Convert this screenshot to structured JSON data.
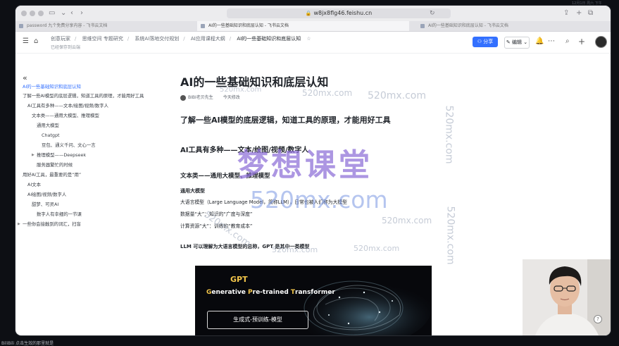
{
  "browser": {
    "url": "w8jx8flg46.feishu.cn",
    "tabs": [
      {
        "label": "password 九个免费分享内容 - 飞书云文档"
      },
      {
        "label": "AI的一些基础知识和底层认知 - 飞书云文档"
      },
      {
        "label": "AI的一些基础知识和底层认知 - 飞书云文档"
      }
    ]
  },
  "header": {
    "breadcrumbs": [
      "创意玩家",
      "思维空间 专题研究",
      "系统AI落地交付规划",
      "AI应用课程大纲",
      "AI的一些基础知识和底层认知"
    ],
    "saved_status": "已经保存到云端",
    "share_label": "分享",
    "edit_label": "编辑"
  },
  "outline": {
    "items": [
      {
        "label": "AI的一些基础知识和底层认知",
        "indent": 0,
        "active": true
      },
      {
        "label": "了解一些AI模型的底层逻辑，知道工具的原理，才能用好工具",
        "indent": 0
      },
      {
        "label": "AI工具有多种——文本/绘图/视频/数字人",
        "indent": 1
      },
      {
        "label": "文本类——通用大模型、推理模型",
        "indent": 2
      },
      {
        "label": "通用大模型",
        "indent": 3
      },
      {
        "label": "Chatgpt",
        "indent": 4
      },
      {
        "label": "豆包、通义千问、文心一言",
        "indent": 4
      },
      {
        "label": "推理模型——Deepseek",
        "indent": 3,
        "expander": true
      },
      {
        "label": "服务器繁忙的时候",
        "indent": 3
      },
      {
        "label": "用好AI工具，最重要的是“用”",
        "indent": 0
      },
      {
        "label": "AI文本",
        "indent": 1
      },
      {
        "label": "AI绘图/视频/数字人",
        "indent": 1
      },
      {
        "label": "甜梦、可灵AI",
        "indent": 2
      },
      {
        "label": "数字人有幸细的一节课",
        "indent": 3
      },
      {
        "label": "一些你会接触到的词汇，扫盲",
        "indent": 0,
        "expander": true
      }
    ]
  },
  "doc": {
    "title": "AI的一些基础知识和底层认知",
    "author": "BIBI老贝先生",
    "modified": "今天修改",
    "lead": "了解一些AI模型的底层逻辑，知道工具的原理，才能用好工具",
    "h2": "AI工具有多种——文本/绘图/视频/数字人",
    "h3": "文本类——通用大模型、推理模型",
    "h4": "通用大模型",
    "paragraphs": [
      "大语言模型（Large Language Model，简称LLM），日常也被人们称为大模型",
      "数据量“大”：知识的“广度与深度”",
      "计算资源“大”：训练的“教育成本”"
    ],
    "llm_note": "LLM 可以理解为大语言模型的总称，GPT 是其中一类模型",
    "image": {
      "title": "GPT",
      "subtitle_parts": [
        "G",
        "enerative ",
        "P",
        "re-trained ",
        "T",
        "ransformer"
      ],
      "button": "生成式-预训练-模型"
    }
  },
  "watermarks": {
    "big": "梦想课堂",
    "url": "520mx.com",
    "small": "520mx.com"
  },
  "footer": {
    "bottom_text": "BiliBili 点击生效的那里就是"
  },
  "system": {
    "clock": "12月1日 周六 下午"
  }
}
